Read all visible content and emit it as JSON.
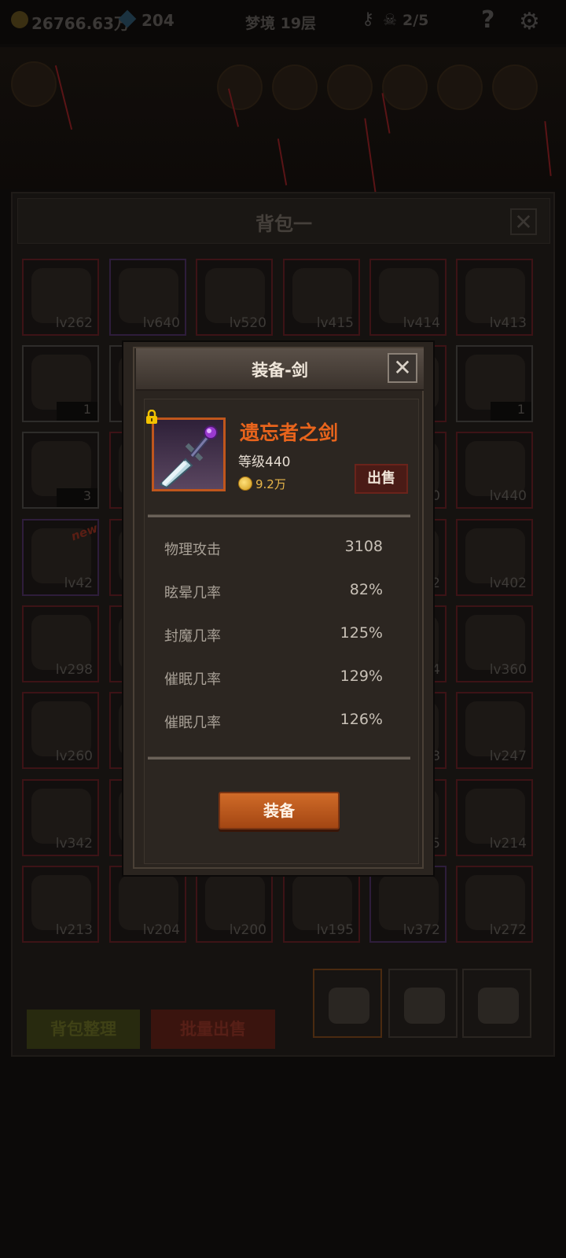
{
  "top_bar": {
    "gold": "26766.63万",
    "gems": "204",
    "floor": "梦境 19层",
    "kills": "2/5",
    "icons": [
      "gold-coin-icon",
      "gem-icon",
      "key-icon",
      "skull-icon",
      "help-icon",
      "settings-icon"
    ]
  },
  "backpack": {
    "title": "背包一",
    "close": "✕",
    "sort_label": "背包整理",
    "bulk_sell_label": "批量出售",
    "tabs": 3,
    "active_tab": 1,
    "slots": [
      {
        "label": "lv262",
        "rarity": "red"
      },
      {
        "label": "lv640",
        "rarity": "purple"
      },
      {
        "label": "lv520",
        "rarity": "red"
      },
      {
        "label": "lv415",
        "rarity": "red"
      },
      {
        "label": "lv414",
        "rarity": "red"
      },
      {
        "label": "lv413",
        "rarity": "red"
      },
      {
        "label": "1",
        "rarity": "gray"
      },
      {
        "label": "",
        "rarity": "gray"
      },
      {
        "label": "",
        "rarity": "red"
      },
      {
        "label": "",
        "rarity": "red"
      },
      {
        "label": "",
        "rarity": "red"
      },
      {
        "label": "1",
        "rarity": "gray"
      },
      {
        "label": "3",
        "rarity": "gray"
      },
      {
        "label": "",
        "rarity": "red"
      },
      {
        "label": "",
        "rarity": "red"
      },
      {
        "label": "",
        "rarity": "red"
      },
      {
        "label": "0",
        "rarity": "red"
      },
      {
        "label": "lv440",
        "rarity": "red"
      },
      {
        "label": "lv42",
        "rarity": "purple"
      },
      {
        "label": "",
        "rarity": "red"
      },
      {
        "label": "",
        "rarity": "red"
      },
      {
        "label": "",
        "rarity": "red"
      },
      {
        "label": "2",
        "rarity": "red"
      },
      {
        "label": "lv402",
        "rarity": "red"
      },
      {
        "label": "lv298",
        "rarity": "red"
      },
      {
        "label": "",
        "rarity": "red"
      },
      {
        "label": "",
        "rarity": "red"
      },
      {
        "label": "",
        "rarity": "red"
      },
      {
        "label": "4",
        "rarity": "red"
      },
      {
        "label": "lv360",
        "rarity": "red"
      },
      {
        "label": "lv260",
        "rarity": "red"
      },
      {
        "label": "",
        "rarity": "red"
      },
      {
        "label": "",
        "rarity": "red"
      },
      {
        "label": "",
        "rarity": "red"
      },
      {
        "label": "8",
        "rarity": "red"
      },
      {
        "label": "lv247",
        "rarity": "red"
      },
      {
        "label": "lv342",
        "rarity": "red"
      },
      {
        "label": "",
        "rarity": "red"
      },
      {
        "label": "",
        "rarity": "red"
      },
      {
        "label": "",
        "rarity": "red"
      },
      {
        "label": "5",
        "rarity": "red"
      },
      {
        "label": "lv214",
        "rarity": "red"
      },
      {
        "label": "lv213",
        "rarity": "red"
      },
      {
        "label": "lv204",
        "rarity": "red"
      },
      {
        "label": "lv200",
        "rarity": "red"
      },
      {
        "label": "lv195",
        "rarity": "red"
      },
      {
        "label": "lv372",
        "rarity": "purple"
      },
      {
        "label": "lv272",
        "rarity": "red"
      }
    ],
    "new_badge": "new"
  },
  "modal": {
    "title": "装备-剑",
    "close": "✕",
    "item_name": "遗忘者之剑",
    "level_text": "等级440",
    "price": "9.2万",
    "sell_label": "出售",
    "stats": [
      {
        "name": "物理攻击",
        "value": "3108"
      },
      {
        "name": "眩晕几率",
        "value": "82%"
      },
      {
        "name": "封魔几率",
        "value": "125%"
      },
      {
        "name": "催眠几率",
        "value": "129%"
      },
      {
        "name": "催眠几率",
        "value": "126%"
      }
    ],
    "equip_label": "装备"
  },
  "colors": {
    "item_name": "#e8641c",
    "price": "#e8b64a",
    "equip_button": "#c05a20"
  }
}
